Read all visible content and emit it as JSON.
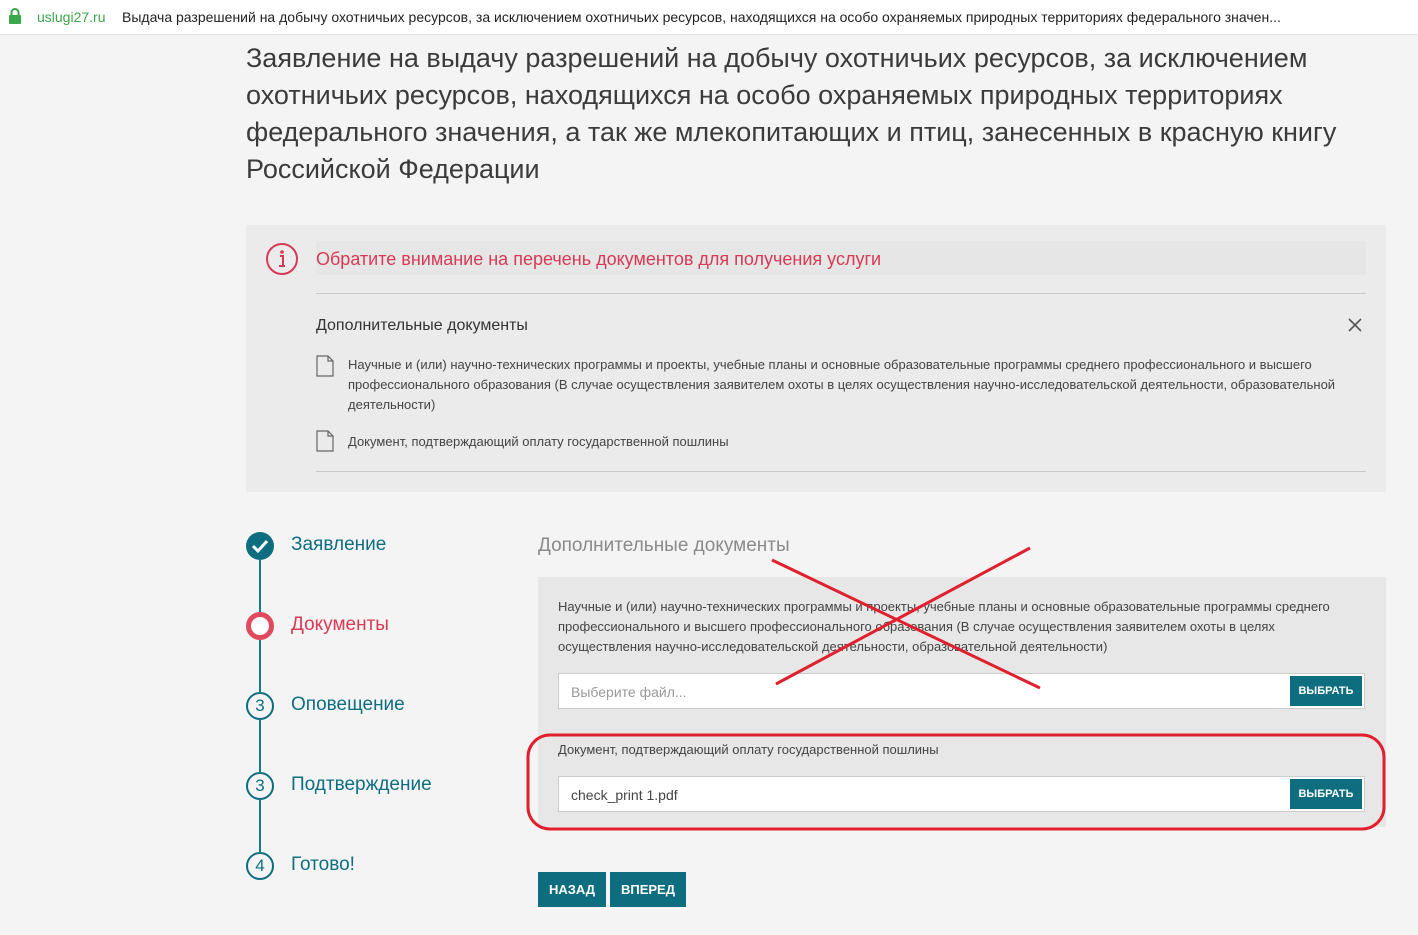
{
  "browser": {
    "domain": "uslugi27.ru",
    "page_title": "Выдача разрешений на добычу охотничьих ресурсов, за исключением охотничьих ресурсов, находящихся на особо охраняемых природных территориях федерального значен..."
  },
  "page": {
    "title": "Заявление на выдачу разрешений на добычу охотничьих ресурсов, за исключением охотничьих ресурсов, находящихся на особо охраняемых природных территориях федерального значения, а так же млекопитающих и птиц, занесенных в красную книгу Российской Федерации"
  },
  "notice": {
    "text": "Обратите внимание на перечень документов для получения услуги",
    "subtitle": "Дополнительные документы",
    "documents": [
      "Научные и (или) научно-технических программы и проекты, учебные планы и основные образовательные программы среднего профессионального и высшего профессионального образования (В случае осуществления заявителем охоты в целях осуществления научно-исследовательской деятельности, образовательной деятельности)",
      "Документ, подтверждающий оплату государственной пошлины"
    ]
  },
  "steps": [
    {
      "label": "Заявление",
      "state": "done"
    },
    {
      "label": "Документы",
      "state": "active"
    },
    {
      "label": "Оповещение",
      "state": "pending",
      "number": "3"
    },
    {
      "label": "Подтверждение",
      "state": "pending",
      "number": "3"
    },
    {
      "label": "Готово!",
      "state": "pending",
      "number": "4"
    }
  ],
  "form": {
    "section_title": "Дополнительные документы",
    "uploads": [
      {
        "description": "Научные и (или) научно-технических программы и проекты, учебные планы и основные образовательные программы среднего профессионального и высшего профессионального образования (В случае осуществления заявителем охоты в целях осуществления научно-исследовательской деятельности, образовательной деятельности)",
        "value": "",
        "placeholder": "Выберите файл...",
        "button": "ВЫБРАТЬ"
      },
      {
        "description": "Документ, подтверждающий оплату государственной пошлины",
        "value": "check_print 1.pdf",
        "placeholder": "Выберите файл...",
        "button": "ВЫБРАТЬ"
      }
    ],
    "back_label": "НАЗАД",
    "next_label": "ВПЕРЕД"
  },
  "colors": {
    "accent": "#0e6e80",
    "alert": "#d63a55",
    "annotation_red": "#e0202c"
  }
}
